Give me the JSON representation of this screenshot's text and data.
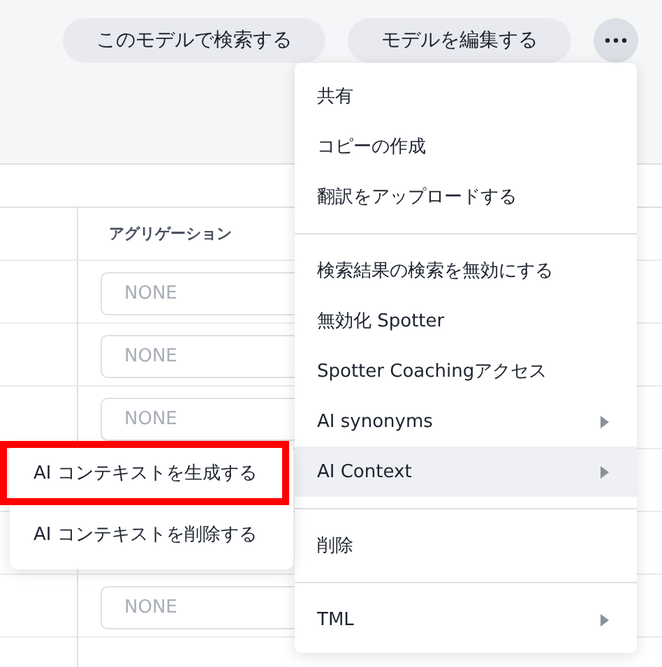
{
  "toolbar": {
    "buttons": [
      "このモデルで検索する",
      "モデルを編集する"
    ],
    "more_open": true
  },
  "table": {
    "columns": [
      "アグリゲーション"
    ],
    "rows": [
      {
        "aggregation": "NONE"
      },
      {
        "aggregation": "NONE"
      },
      {
        "aggregation": "NONE"
      },
      {},
      {},
      {
        "aggregation": "NONE"
      },
      {}
    ]
  },
  "menu": {
    "groups": [
      [
        {
          "label": "共有",
          "submenu": false,
          "highlighted": false
        },
        {
          "label": "コピーの作成",
          "submenu": false,
          "highlighted": false
        },
        {
          "label": "翻訳をアップロードする",
          "submenu": false,
          "highlighted": false
        }
      ],
      [
        {
          "label": "検索結果の検索を無効にする",
          "submenu": false,
          "highlighted": false
        },
        {
          "label": "無効化 Spotter",
          "submenu": false,
          "highlighted": false
        },
        {
          "label": "Spotter Coachingアクセス",
          "submenu": false,
          "highlighted": false
        },
        {
          "label": "AI synonyms",
          "submenu": true,
          "highlighted": false
        },
        {
          "label": "AI Context",
          "submenu": true,
          "highlighted": true
        }
      ],
      [
        {
          "label": "削除",
          "submenu": false,
          "highlighted": false
        }
      ],
      [
        {
          "label": "TML",
          "submenu": true,
          "highlighted": false
        }
      ]
    ]
  },
  "submenu": {
    "items": [
      {
        "label": "AI コンテキストを生成する",
        "outlined": true
      },
      {
        "label": "AI コンテキストを削除する",
        "outlined": false
      }
    ]
  }
}
